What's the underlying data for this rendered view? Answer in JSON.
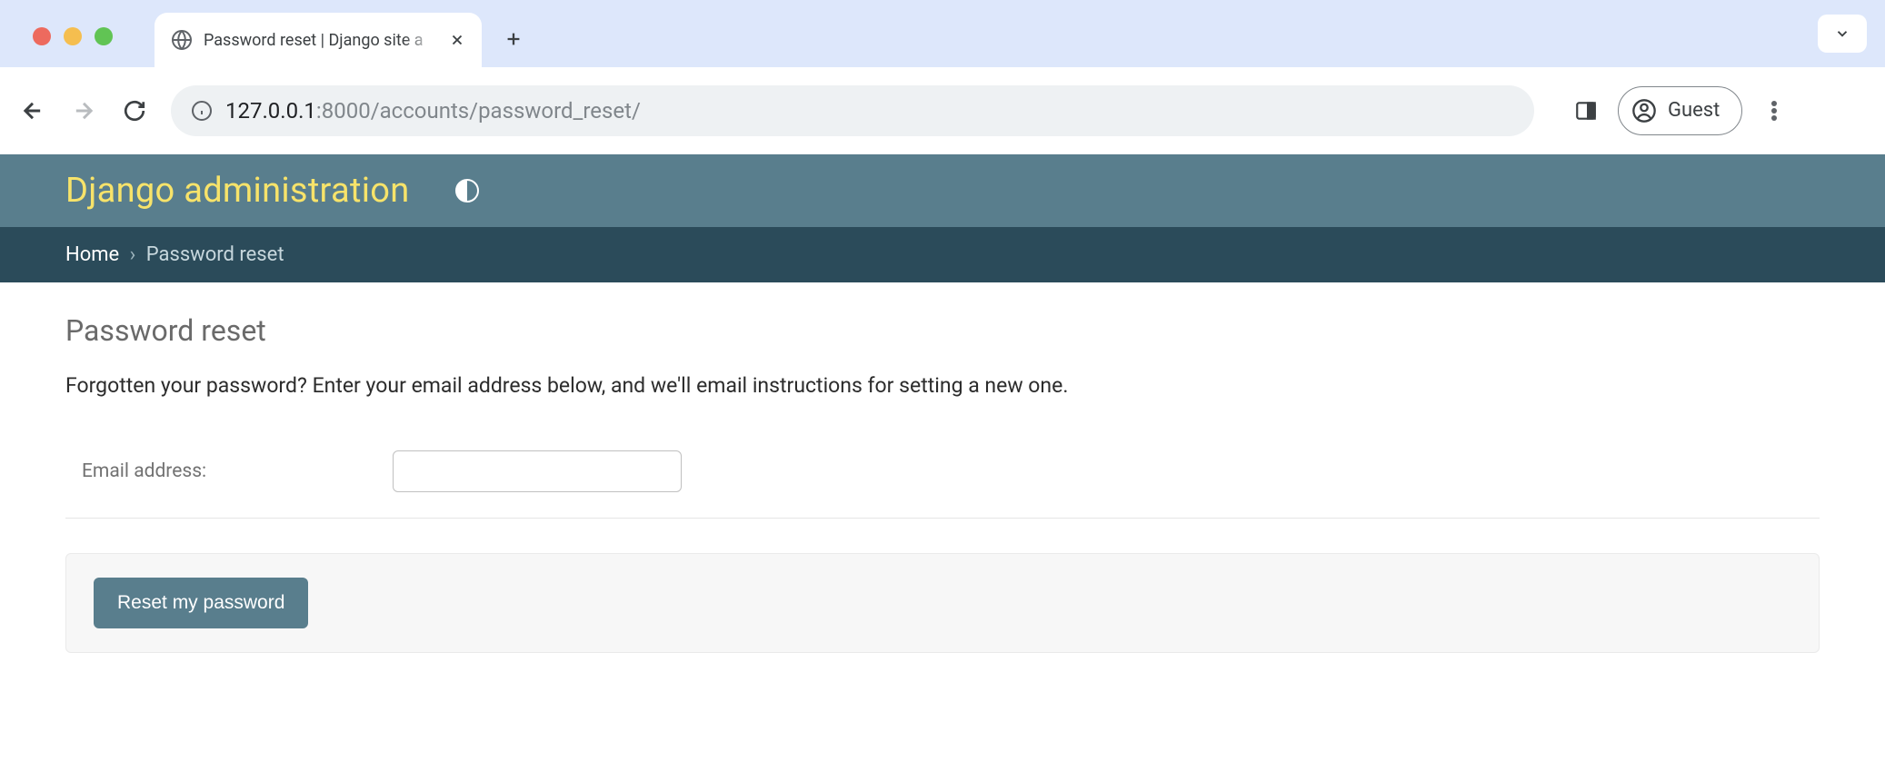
{
  "browser": {
    "tab_title": "Password reset | Django site a",
    "url_host": "127.0.0.1",
    "url_port": ":8000",
    "url_path": "/accounts/password_reset/",
    "guest_label": "Guest"
  },
  "header": {
    "site_title": "Django administration"
  },
  "breadcrumbs": {
    "home": "Home",
    "sep": "›",
    "current": "Password reset"
  },
  "page": {
    "heading": "Password reset",
    "help": "Forgotten your password? Enter your email address below, and we'll email instructions for setting a new one.",
    "email_label": "Email address:",
    "submit_label": "Reset my password"
  }
}
